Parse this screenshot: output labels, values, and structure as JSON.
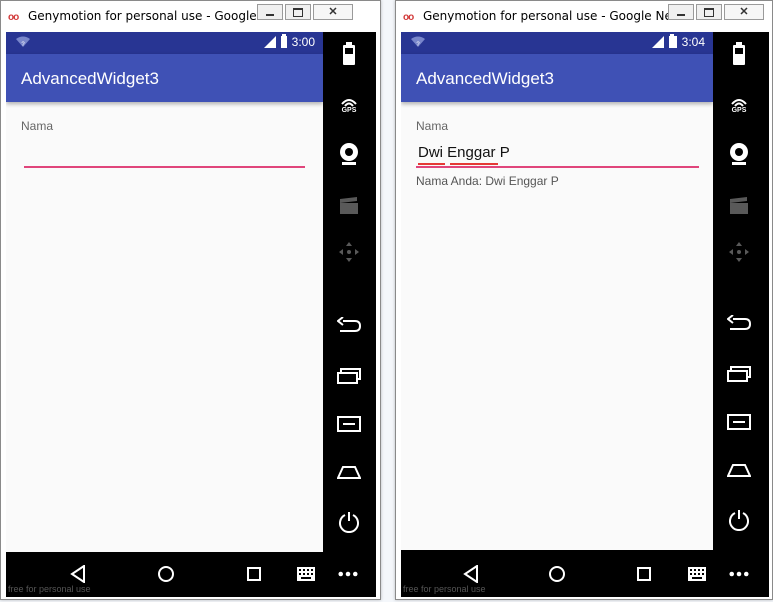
{
  "windows": [
    {
      "title": "Genymotion for personal use - Google Nex...",
      "status": {
        "time": "3:00"
      },
      "app_title": "AdvancedWidget3",
      "form": {
        "label": "Nama",
        "input_value": "",
        "result": ""
      },
      "footer": "free for personal use"
    },
    {
      "title": "Genymotion for personal use - Google Nex...",
      "status": {
        "time": "3:04"
      },
      "app_title": "AdvancedWidget3",
      "form": {
        "label": "Nama",
        "input_value": "Dwi Enggar P",
        "result": "Nama Anda: Dwi Enggar P"
      },
      "footer": "free for personal use"
    }
  ],
  "sidebar": {
    "gps_label": "GPS"
  },
  "colors": {
    "status_bar": "#283593",
    "app_bar": "#3f51b5",
    "underline": "#e0457b",
    "background": "#fafafa"
  }
}
